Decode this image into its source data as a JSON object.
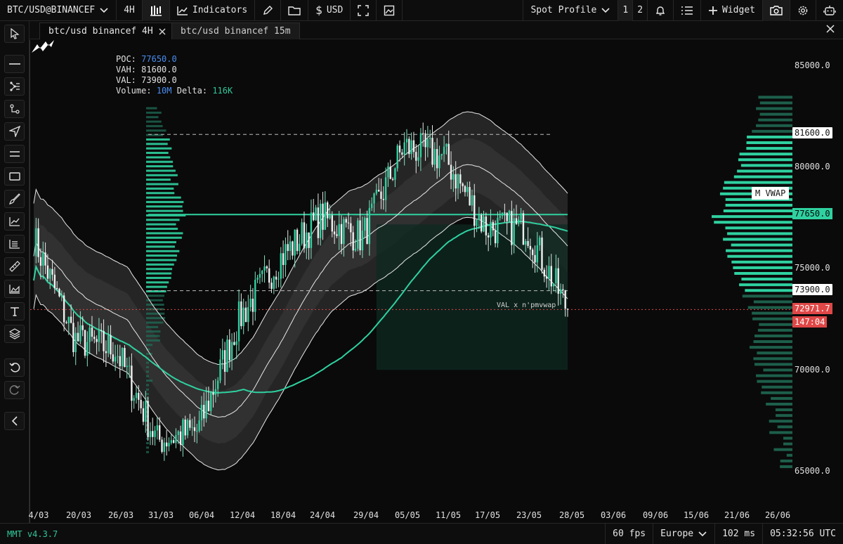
{
  "toolbar": {
    "symbol": "BTC/USD@BINANCEF",
    "timeframe": "4H",
    "indicators_label": "Indicators",
    "currency_label": "USD",
    "profile_label": "Spot Profile",
    "layout_1": "1",
    "layout_2": "2",
    "widget_label": "Widget"
  },
  "tabs": [
    {
      "label": "btc/usd binancef 4H",
      "active": true
    },
    {
      "label": "btc/usd binancef 15m",
      "active": false
    }
  ],
  "legend": {
    "poc_key": "POC:",
    "poc_value": "77650.0",
    "vah_key": "VAH:",
    "vah_value": "81600.0",
    "val_key": "VAL:",
    "val_value": "73900.0",
    "volume_key": "Volume:",
    "volume_value": "10M",
    "delta_key": "Delta:",
    "delta_value": "116K"
  },
  "price_axis": {
    "ticks": [
      "85000.0",
      "80000.0",
      "75000.0",
      "70000.0",
      "65000.0"
    ],
    "vah_label": "81600.0",
    "poc_label": "77650.0",
    "val_label": "73900.0",
    "current_price": "72971.7",
    "countdown": "147:04",
    "mvwap_label": "M VWAP"
  },
  "annotation": "VAL x n'pmvwap",
  "time_axis": [
    "4/03",
    "20/03",
    "26/03",
    "31/03",
    "06/04",
    "12/04",
    "18/04",
    "24/04",
    "29/04",
    "05/05",
    "11/05",
    "17/05",
    "23/05",
    "28/05",
    "03/06",
    "09/06",
    "15/06",
    "21/06",
    "26/06"
  ],
  "colors": {
    "background": "#0a0a0a",
    "accent_green": "#2fd1a0",
    "price_red": "#e04747",
    "poc_blue": "#4a8df0"
  },
  "status": {
    "version": "MMT v4.3.7",
    "fps": "60 fps",
    "region": "Europe",
    "latency": "102 ms",
    "clock": "05:32:56 UTC"
  },
  "icons": {
    "left_tools": [
      "cursor-icon",
      "horizontal-line-icon",
      "pitchfork-icon",
      "path-icon",
      "arrow-icon",
      "parallel-lines-icon",
      "rectangle-icon",
      "brush-icon",
      "chart-line-icon",
      "list-icon",
      "ruler-icon",
      "area-chart-icon",
      "text-icon",
      "layers-icon",
      "undo-icon",
      "redo-icon",
      "collapse-icon"
    ]
  },
  "chart_data": {
    "type": "candlestick",
    "title": "btc/usd binancef 4H",
    "x": [
      "4/03",
      "20/03",
      "26/03",
      "31/03",
      "06/04",
      "12/04",
      "18/04",
      "24/04",
      "29/04",
      "05/05",
      "11/05",
      "17/05",
      "23/05",
      "28/05"
    ],
    "close": [
      76500,
      71500,
      71000,
      66500,
      67000,
      72500,
      75500,
      77500,
      76500,
      81000,
      80500,
      77000,
      77000,
      72971.7
    ],
    "ylim": [
      64000,
      86000
    ],
    "value_area": {
      "poc": 77650.0,
      "vah": 81600.0,
      "val": 73900.0
    },
    "current_price": 72971.7,
    "legend_position": "top-left",
    "grid": false
  }
}
